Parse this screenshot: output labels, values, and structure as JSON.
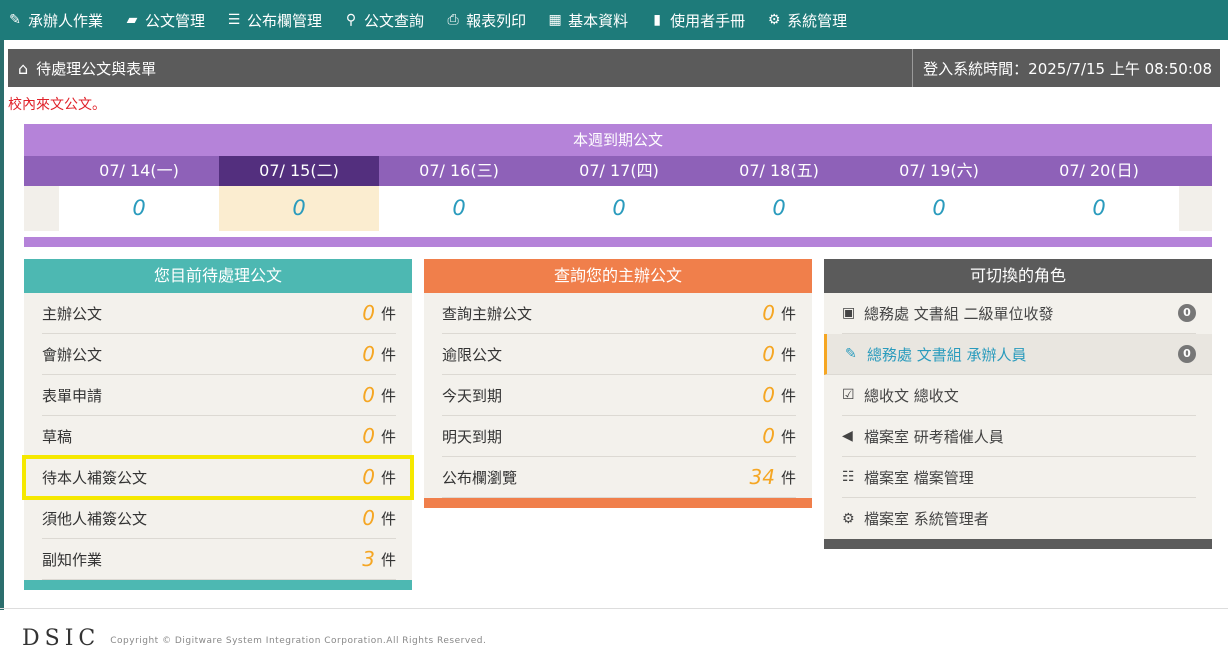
{
  "nav": [
    {
      "label": "承辦人作業",
      "icon": "pencil-icon"
    },
    {
      "label": "公文管理",
      "icon": "folder-icon"
    },
    {
      "label": "公布欄管理",
      "icon": "list-icon"
    },
    {
      "label": "公文查詢",
      "icon": "search-icon"
    },
    {
      "label": "報表列印",
      "icon": "printer-icon"
    },
    {
      "label": "基本資料",
      "icon": "calendar-icon"
    },
    {
      "label": "使用者手冊",
      "icon": "book-icon"
    },
    {
      "label": "系統管理",
      "icon": "gear-icon"
    }
  ],
  "header": {
    "title": "待處理公文與表單",
    "login_time": "登入系統時間：2025/7/15 上午 08:50:08"
  },
  "notice": "校內來文公文。",
  "week": {
    "title": "本週到期公文",
    "days": [
      {
        "label": "07/ 14(一)",
        "count": "0"
      },
      {
        "label": "07/ 15(二)",
        "count": "0"
      },
      {
        "label": "07/ 16(三)",
        "count": "0"
      },
      {
        "label": "07/ 17(四)",
        "count": "0"
      },
      {
        "label": "07/ 18(五)",
        "count": "0"
      },
      {
        "label": "07/ 19(六)",
        "count": "0"
      },
      {
        "label": "07/ 20(日)",
        "count": "0"
      }
    ]
  },
  "pending": {
    "title": "您目前待處理公文",
    "unit": "件",
    "rows": [
      {
        "label": "主辦公文",
        "count": "0"
      },
      {
        "label": "會辦公文",
        "count": "0"
      },
      {
        "label": "表單申請",
        "count": "0"
      },
      {
        "label": "草稿",
        "count": "0"
      },
      {
        "label": "待本人補簽公文",
        "count": "0"
      },
      {
        "label": "須他人補簽公文",
        "count": "0"
      },
      {
        "label": "副知作業",
        "count": "3"
      }
    ]
  },
  "query": {
    "title": "查詢您的主辦公文",
    "unit": "件",
    "rows": [
      {
        "label": "查詢主辦公文",
        "count": "0"
      },
      {
        "label": "逾限公文",
        "count": "0"
      },
      {
        "label": "今天到期",
        "count": "0"
      },
      {
        "label": "明天到期",
        "count": "0"
      },
      {
        "label": "公布欄瀏覽",
        "count": "34"
      }
    ]
  },
  "roles": {
    "title": "可切換的角色",
    "rows": [
      {
        "label": "總務處 文書組 二級單位收發",
        "icon": "inbox-icon",
        "badge": "0"
      },
      {
        "label": "總務處 文書組 承辦人員",
        "icon": "pencil-icon",
        "badge": "0"
      },
      {
        "label": "總收文 總收文",
        "icon": "checkbox-icon"
      },
      {
        "label": "檔案室 研考稽催人員",
        "icon": "megaphone-icon"
      },
      {
        "label": "檔案室 檔案管理",
        "icon": "server-icon"
      },
      {
        "label": "檔案室 系統管理者",
        "icon": "gear-icon"
      }
    ]
  },
  "footer": {
    "brand": "DSIC",
    "copyright": "Copyright © Digitware System Integration Corporation.All Rights Reserved."
  },
  "colors": {
    "nav_bg": "#1e7b7a",
    "week_purple": "#b583d9",
    "teal": "#4db8b2",
    "orange": "#f07f4b",
    "highlight": "#f5e800",
    "count": "#f5a623"
  }
}
